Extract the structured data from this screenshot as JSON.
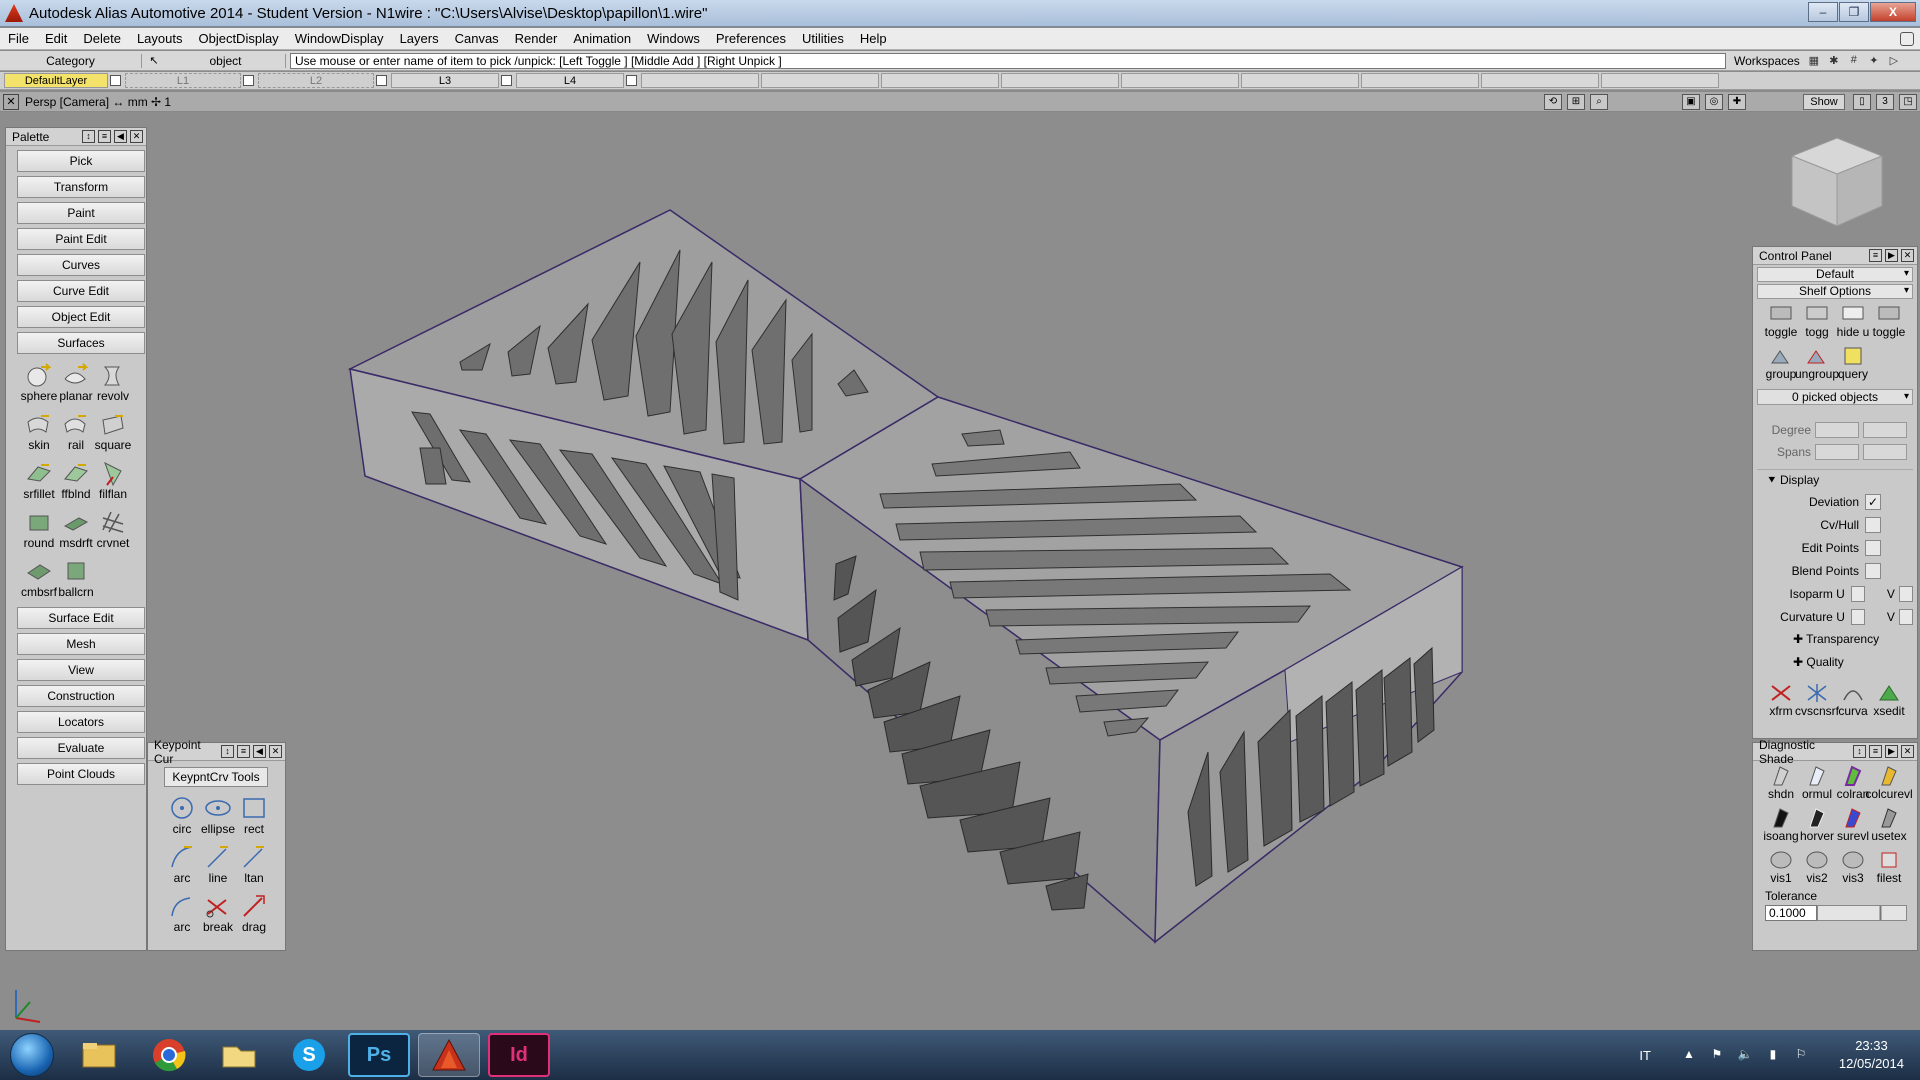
{
  "window": {
    "title": "Autodesk Alias Automotive 2014   - Student Version   - N1wire : \"C:\\Users\\Alvise\\Desktop\\papillon\\1.wire\"",
    "controls": [
      "–",
      "❐",
      "X"
    ]
  },
  "menu": [
    "File",
    "Edit",
    "Delete",
    "Layouts",
    "ObjectDisplay",
    "WindowDisplay",
    "Layers",
    "Canvas",
    "Render",
    "Animation",
    "Windows",
    "Preferences",
    "Utilities",
    "Help"
  ],
  "prompt": {
    "category": "Category",
    "object": "object",
    "text": "Use mouse or enter name of item to pick /unpick: [Left Toggle ] [Middle Add ] [Right Unpick ]",
    "workspaces": "Workspaces"
  },
  "layers": {
    "default": "DefaultLayer",
    "l1": "L1",
    "l2": "L2",
    "l3": "L3",
    "l4": "L4"
  },
  "viewport": {
    "title": "Persp [Camera] ↔ mm   ✢ 1",
    "show": "Show"
  },
  "palette": {
    "title": "Palette",
    "buttons_top": [
      "Pick",
      "Transform",
      "Paint",
      "Paint Edit",
      "Curves",
      "Curve Edit",
      "Object Edit",
      "Surfaces"
    ],
    "surface_tools": [
      "sphere",
      "planar",
      "revolv",
      "skin",
      "rail",
      "square",
      "srfillet",
      "ffblnd",
      "filflan",
      "round",
      "msdrft",
      "crvnet",
      "cmbsrf",
      "ballcrn"
    ],
    "buttons_bottom": [
      "Surface Edit",
      "Mesh",
      "View",
      "Construction",
      "Locators",
      "Evaluate",
      "Point Clouds"
    ]
  },
  "keypoint": {
    "title": "Keypoint Cur",
    "tab": "KeypntCrv Tools",
    "tools": [
      "circ",
      "ellipse",
      "rect",
      "arc",
      "line",
      "ltan",
      "arc",
      "break",
      "drag"
    ]
  },
  "control_panel": {
    "title": "Control Panel",
    "preset": "Default",
    "shelf_options": "Shelf Options",
    "shelf_row1": [
      "toggle",
      "togg",
      "hide u",
      "toggle"
    ],
    "shelf_row2": [
      "group",
      "ungroup",
      "query"
    ],
    "picked": "0 picked objects",
    "degree_label": "Degree",
    "spans_label": "Spans",
    "display_title": "Display",
    "deviation": "Deviation",
    "deviation_checked": "✓",
    "cvhull": "Cv/Hull",
    "edit_points": "Edit Points",
    "blend_points": "Blend Points",
    "isoparm_u": "Isoparm U",
    "curvature_u": "Curvature U",
    "v_label": "V",
    "transparency": "Transparency",
    "quality": "Quality",
    "shelf_row3": [
      "xfrm",
      "cvscnsrf",
      "curva",
      "xsedit"
    ]
  },
  "diagnostic": {
    "title": "Diagnostic Shade",
    "tools_row1": [
      "shdn",
      "ormul",
      "colran",
      "colcurevl"
    ],
    "tools_row2": [
      "isoang",
      "horver",
      "surevl",
      "usetex"
    ],
    "tools_row3": [
      "vis1",
      "vis2",
      "vis3",
      "filest"
    ],
    "tolerance_label": "Tolerance",
    "tolerance_value": "0.1000"
  },
  "taskbar": {
    "apps": [
      "explorer",
      "chrome",
      "folder",
      "skype",
      "photoshop",
      "alias",
      "indesign"
    ],
    "ps_label": "Ps",
    "id_label": "Id",
    "skype_label": "S",
    "alias_label": "A",
    "lang": "IT",
    "time": "23:33",
    "date": "12/05/2014"
  },
  "colors": {
    "model_face_light": "#a3a3a3",
    "model_face_dark": "#7d7d7d",
    "model_edge": "#3a2a66",
    "layer_active": "#f4e36a"
  }
}
